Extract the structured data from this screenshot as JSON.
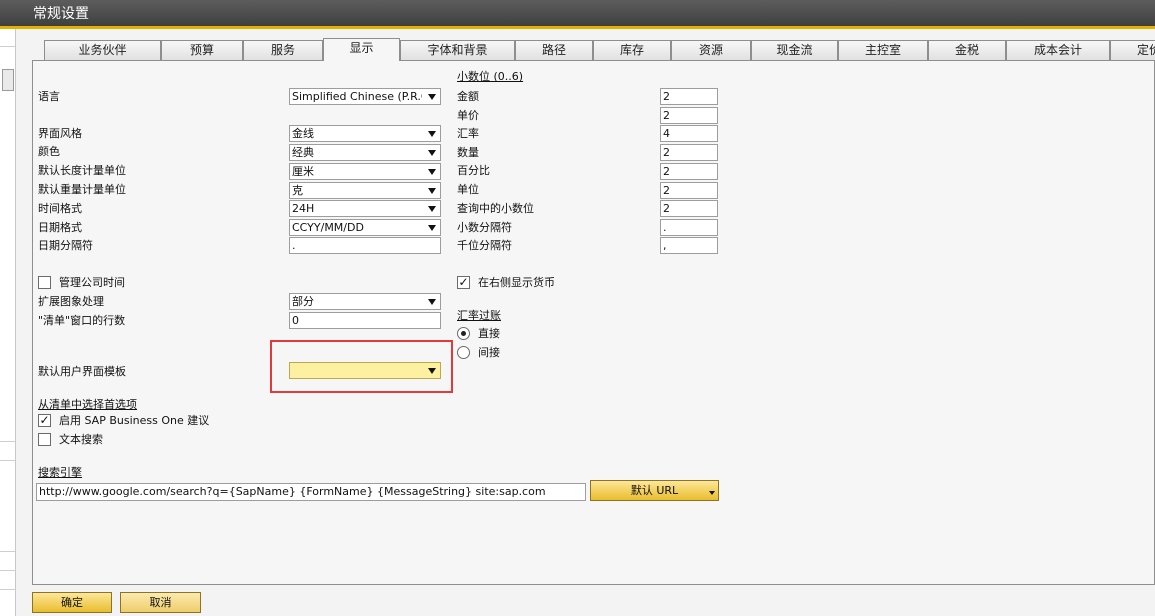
{
  "window": {
    "title": "常规设置"
  },
  "tabs": [
    {
      "label": "业务伙伴"
    },
    {
      "label": "预算"
    },
    {
      "label": "服务"
    },
    {
      "label": "显示"
    },
    {
      "label": "字体和背景"
    },
    {
      "label": "路径"
    },
    {
      "label": "库存"
    },
    {
      "label": "资源"
    },
    {
      "label": "现金流"
    },
    {
      "label": "主控室"
    },
    {
      "label": "金税"
    },
    {
      "label": "成本会计"
    },
    {
      "label": "定价"
    }
  ],
  "left": {
    "language": {
      "label": "语言",
      "value": "Simplified Chinese (P.R.C)"
    },
    "ui_style": {
      "label": "界面风格",
      "value": "金线"
    },
    "color": {
      "label": "颜色",
      "value": "经典"
    },
    "length_unit": {
      "label": "默认长度计量单位",
      "value": "厘米"
    },
    "weight_unit": {
      "label": "默认重量计量单位",
      "value": "克"
    },
    "time_format": {
      "label": "时间格式",
      "value": "24H"
    },
    "date_format": {
      "label": "日期格式",
      "value": "CCYY/MM/DD"
    },
    "date_separator": {
      "label": "日期分隔符",
      "value": "."
    },
    "manage_company_time": {
      "label": "管理公司时间",
      "checked": false
    },
    "extended_image_processing": {
      "label": "扩展图象处理",
      "value": "部分"
    },
    "list_window_rows": {
      "label": "\"清单\"窗口的行数",
      "value": "0"
    },
    "default_ui_template": {
      "label": "默认用户界面模板",
      "value": ""
    }
  },
  "right": {
    "decimals_header": "小数位 (0..6)",
    "decimals": [
      {
        "label": "金额",
        "value": "2"
      },
      {
        "label": "单价",
        "value": "2"
      },
      {
        "label": "汇率",
        "value": "4"
      },
      {
        "label": "数量",
        "value": "2"
      },
      {
        "label": "百分比",
        "value": "2"
      },
      {
        "label": "单位",
        "value": "2"
      },
      {
        "label": "查询中的小数位",
        "value": "2"
      },
      {
        "label": "小数分隔符",
        "value": "."
      },
      {
        "label": "千位分隔符",
        "value": ","
      }
    ],
    "show_currency_right": {
      "label": "在右侧显示货币",
      "checked": true
    },
    "rate_section": "汇率过账",
    "rate_direct": {
      "label": "直接",
      "selected": true
    },
    "rate_indirect": {
      "label": "间接",
      "selected": false
    }
  },
  "list_selection": {
    "header": "从清单中选择首选项",
    "enable_sap_suggestions": {
      "label": "启用 SAP Business One 建议",
      "checked": true
    },
    "text_search": {
      "label": "文本搜索",
      "checked": false
    }
  },
  "search_engine": {
    "header": "搜索引擎",
    "url": "http://www.google.com/search?q={SapName} {FormName} {MessageString} site:sap.com",
    "default_url_button": "默认 URL"
  },
  "footer": {
    "ok": "确定",
    "cancel": "取消"
  },
  "colors": {
    "accent_gold": "#e3b100",
    "highlight_red": "#e23a3a",
    "yellow_field": "#fdf0a0"
  }
}
